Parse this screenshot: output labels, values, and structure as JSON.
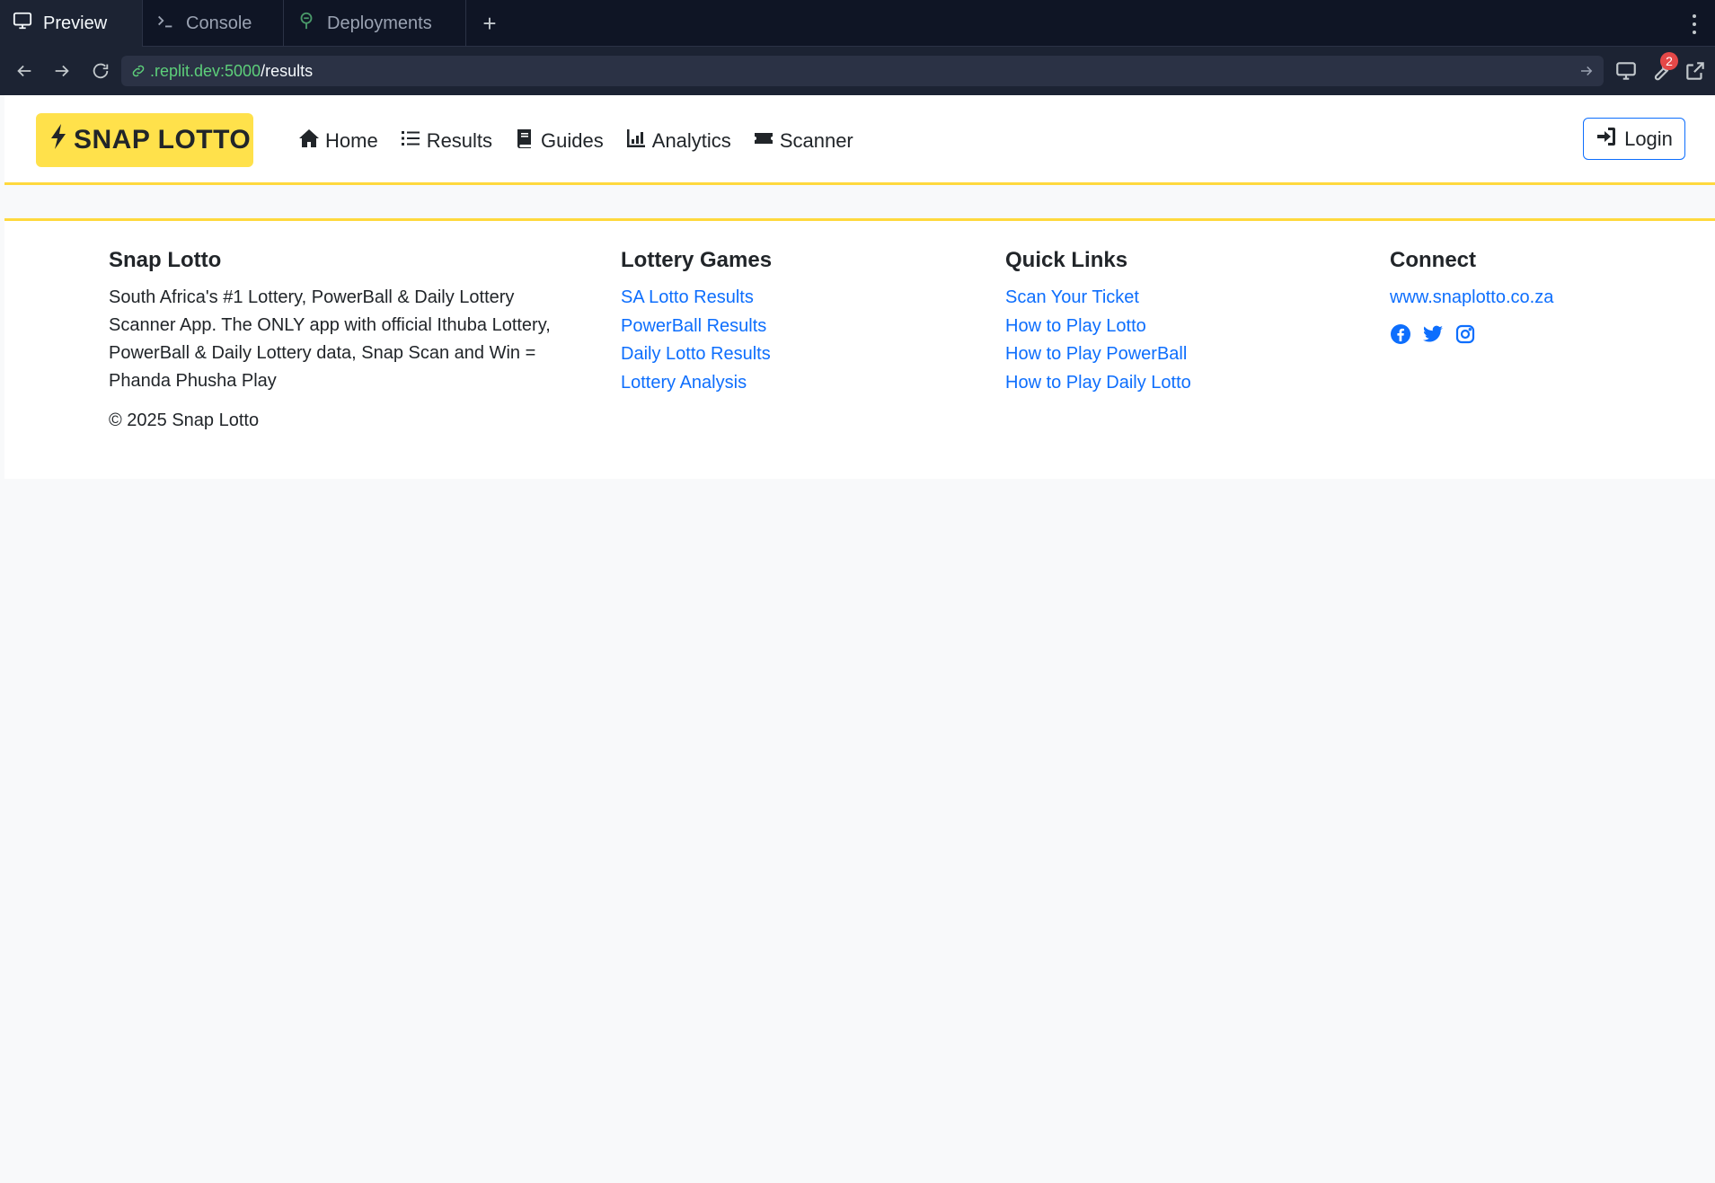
{
  "ide": {
    "tabs": [
      {
        "label": "Preview",
        "icon": "monitor-icon"
      },
      {
        "label": "Console",
        "icon": "terminal-icon"
      },
      {
        "label": "Deployments",
        "icon": "deploy-icon"
      }
    ],
    "url_host": ".replit.dev:5000",
    "url_path": "/results",
    "devtools_badge": "2"
  },
  "header": {
    "brand": "SNAP LOTTO",
    "nav": [
      {
        "label": "Home",
        "icon": "home-icon"
      },
      {
        "label": "Results",
        "icon": "list-ol-icon"
      },
      {
        "label": "Guides",
        "icon": "book-icon"
      },
      {
        "label": "Analytics",
        "icon": "chart-icon"
      },
      {
        "label": "Scanner",
        "icon": "ticket-icon"
      }
    ],
    "login": "Login"
  },
  "footer": {
    "about": {
      "title": "Snap Lotto",
      "text": "South Africa's #1 Lottery, PowerBall & Daily Lottery Scanner App. The ONLY app with official Ithuba Lottery, PowerBall & Daily Lottery data, Snap Scan and Win = Phanda Phusha Play",
      "copyright": "© 2025 Snap Lotto"
    },
    "games": {
      "title": "Lottery Games",
      "links": [
        "SA Lotto Results",
        "PowerBall Results",
        "Daily Lotto Results",
        "Lottery Analysis"
      ]
    },
    "quick": {
      "title": "Quick Links",
      "links": [
        "Scan Your Ticket",
        "How to Play Lotto",
        "How to Play PowerBall",
        "How to Play Daily Lotto"
      ]
    },
    "connect": {
      "title": "Connect",
      "website": "www.snaplotto.co.za",
      "social": [
        "facebook-icon",
        "twitter-icon",
        "instagram-icon"
      ]
    }
  },
  "colors": {
    "brand_yellow": "#ffe14b",
    "link_blue": "#0d6efd",
    "ide_dark": "#0f1525"
  }
}
